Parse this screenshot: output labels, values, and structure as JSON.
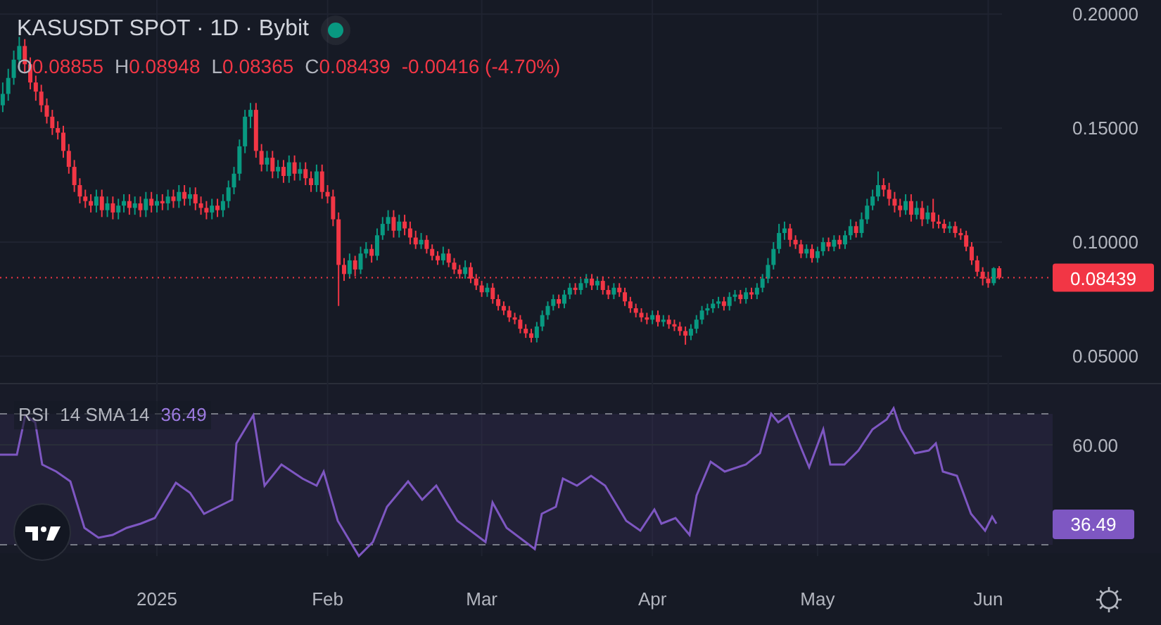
{
  "header": {
    "symbol_line": "KASUSDT SPOT · 1D · Bybit",
    "market_open": true,
    "ohlc": [
      {
        "label": "O",
        "value": "0.08855"
      },
      {
        "label": "H",
        "value": "0.08948"
      },
      {
        "label": "L",
        "value": "0.08365"
      },
      {
        "label": "C",
        "value": "0.08439"
      }
    ],
    "change": "-0.00416 (-4.70%)"
  },
  "price_chart": {
    "chart_data": {
      "type": "candlestick",
      "categories": [
        null,
        null,
        null,
        null,
        null,
        null,
        null,
        null,
        null,
        null,
        null,
        null,
        null,
        null,
        null,
        null,
        null,
        null,
        null,
        null,
        null,
        null,
        null,
        null,
        null,
        null,
        null,
        null,
        null,
        null,
        null,
        null,
        null,
        null,
        null,
        null,
        null,
        null,
        null,
        null,
        null,
        null,
        null,
        null,
        null,
        null,
        null,
        null,
        null,
        null,
        null,
        null,
        null,
        null,
        null,
        null,
        null,
        null,
        null,
        null,
        null,
        null,
        null,
        null,
        null,
        null,
        null,
        null,
        null,
        null,
        null,
        null,
        null,
        null,
        null,
        null,
        null,
        null,
        null,
        null,
        null,
        null,
        null,
        null,
        null,
        null,
        null,
        null,
        null,
        null,
        null,
        null,
        null,
        null,
        null,
        null,
        null,
        null,
        null,
        null,
        null,
        null,
        null,
        null,
        null,
        null,
        null,
        null,
        null,
        null,
        null,
        null,
        null,
        null,
        null,
        null,
        null,
        null,
        null,
        null,
        null,
        null,
        null,
        null,
        null,
        null,
        null,
        null,
        null,
        null,
        null,
        null,
        null,
        null,
        null,
        null,
        null,
        null,
        null,
        null,
        null,
        null,
        null,
        null,
        null,
        null,
        null,
        null,
        null,
        null,
        null,
        null,
        null,
        null,
        null,
        null,
        null,
        null,
        null,
        null,
        null,
        null,
        null,
        null,
        null,
        null,
        null,
        null,
        null,
        null,
        null,
        null,
        null,
        null,
        null,
        null,
        null,
        null,
        null,
        null,
        null,
        null
      ],
      "ohlc": [
        [
          0.16,
          0.17,
          0.157,
          0.165
        ],
        [
          0.165,
          0.176,
          0.162,
          0.172
        ],
        [
          0.172,
          0.184,
          0.169,
          0.18
        ],
        [
          0.18,
          0.19,
          0.176,
          0.186
        ],
        [
          0.186,
          0.189,
          0.174,
          0.178
        ],
        [
          0.178,
          0.181,
          0.167,
          0.17
        ],
        [
          0.17,
          0.173,
          0.162,
          0.166
        ],
        [
          0.166,
          0.169,
          0.157,
          0.16
        ],
        [
          0.16,
          0.163,
          0.152,
          0.155
        ],
        [
          0.155,
          0.158,
          0.147,
          0.15
        ],
        [
          0.15,
          0.153,
          0.145,
          0.148
        ],
        [
          0.148,
          0.151,
          0.137,
          0.14
        ],
        [
          0.14,
          0.143,
          0.13,
          0.133
        ],
        [
          0.133,
          0.136,
          0.122,
          0.125
        ],
        [
          0.125,
          0.128,
          0.117,
          0.12
        ],
        [
          0.12,
          0.123,
          0.115,
          0.118
        ],
        [
          0.118,
          0.121,
          0.113,
          0.116
        ],
        [
          0.116,
          0.123,
          0.113,
          0.12
        ],
        [
          0.12,
          0.123,
          0.111,
          0.114
        ],
        [
          0.114,
          0.12,
          0.111,
          0.117
        ],
        [
          0.117,
          0.12,
          0.11,
          0.113
        ],
        [
          0.113,
          0.119,
          0.11,
          0.116
        ],
        [
          0.116,
          0.121,
          0.113,
          0.118
        ],
        [
          0.118,
          0.121,
          0.112,
          0.115
        ],
        [
          0.115,
          0.12,
          0.112,
          0.117
        ],
        [
          0.117,
          0.12,
          0.111,
          0.114
        ],
        [
          0.114,
          0.122,
          0.111,
          0.119
        ],
        [
          0.119,
          0.122,
          0.113,
          0.116
        ],
        [
          0.116,
          0.121,
          0.113,
          0.118
        ],
        [
          0.118,
          0.121,
          0.114,
          0.117
        ],
        [
          0.117,
          0.123,
          0.114,
          0.12
        ],
        [
          0.12,
          0.123,
          0.115,
          0.118
        ],
        [
          0.118,
          0.125,
          0.115,
          0.122
        ],
        [
          0.122,
          0.125,
          0.116,
          0.119
        ],
        [
          0.119,
          0.124,
          0.116,
          0.121
        ],
        [
          0.121,
          0.124,
          0.114,
          0.117
        ],
        [
          0.117,
          0.12,
          0.112,
          0.115
        ],
        [
          0.115,
          0.118,
          0.11,
          0.113
        ],
        [
          0.113,
          0.119,
          0.11,
          0.116
        ],
        [
          0.116,
          0.119,
          0.111,
          0.114
        ],
        [
          0.114,
          0.121,
          0.111,
          0.118
        ],
        [
          0.118,
          0.127,
          0.115,
          0.124
        ],
        [
          0.124,
          0.133,
          0.121,
          0.13
        ],
        [
          0.13,
          0.145,
          0.127,
          0.142
        ],
        [
          0.142,
          0.158,
          0.139,
          0.155
        ],
        [
          0.155,
          0.161,
          0.15,
          0.158
        ],
        [
          0.158,
          0.161,
          0.137,
          0.14
        ],
        [
          0.14,
          0.143,
          0.131,
          0.134
        ],
        [
          0.134,
          0.14,
          0.131,
          0.137
        ],
        [
          0.137,
          0.14,
          0.128,
          0.131
        ],
        [
          0.131,
          0.136,
          0.128,
          0.133
        ],
        [
          0.133,
          0.136,
          0.126,
          0.129
        ],
        [
          0.129,
          0.138,
          0.126,
          0.135
        ],
        [
          0.135,
          0.138,
          0.127,
          0.13
        ],
        [
          0.13,
          0.135,
          0.127,
          0.132
        ],
        [
          0.132,
          0.135,
          0.125,
          0.128
        ],
        [
          0.128,
          0.131,
          0.122,
          0.125
        ],
        [
          0.125,
          0.134,
          0.122,
          0.131
        ],
        [
          0.131,
          0.134,
          0.119,
          0.122
        ],
        [
          0.122,
          0.125,
          0.117,
          0.12
        ],
        [
          0.12,
          0.123,
          0.107,
          0.11
        ],
        [
          0.11,
          0.113,
          0.072,
          0.09
        ],
        [
          0.09,
          0.093,
          0.083,
          0.086
        ],
        [
          0.086,
          0.095,
          0.084,
          0.092
        ],
        [
          0.092,
          0.094,
          0.085,
          0.088
        ],
        [
          0.088,
          0.098,
          0.086,
          0.095
        ],
        [
          0.095,
          0.1,
          0.093,
          0.097
        ],
        [
          0.097,
          0.099,
          0.091,
          0.094
        ],
        [
          0.094,
          0.106,
          0.092,
          0.103
        ],
        [
          0.103,
          0.111,
          0.101,
          0.108
        ],
        [
          0.108,
          0.114,
          0.105,
          0.111
        ],
        [
          0.111,
          0.114,
          0.102,
          0.105
        ],
        [
          0.105,
          0.112,
          0.102,
          0.109
        ],
        [
          0.109,
          0.112,
          0.103,
          0.106
        ],
        [
          0.106,
          0.109,
          0.099,
          0.102
        ],
        [
          0.102,
          0.105,
          0.097,
          0.099
        ],
        [
          0.099,
          0.104,
          0.097,
          0.101
        ],
        [
          0.101,
          0.103,
          0.095,
          0.097
        ],
        [
          0.097,
          0.099,
          0.092,
          0.094
        ],
        [
          0.094,
          0.096,
          0.09,
          0.092
        ],
        [
          0.092,
          0.098,
          0.09,
          0.095
        ],
        [
          0.095,
          0.097,
          0.089,
          0.091
        ],
        [
          0.091,
          0.093,
          0.086,
          0.088
        ],
        [
          0.088,
          0.09,
          0.084,
          0.086
        ],
        [
          0.086,
          0.092,
          0.084,
          0.089
        ],
        [
          0.089,
          0.091,
          0.082,
          0.084
        ],
        [
          0.084,
          0.086,
          0.079,
          0.081
        ],
        [
          0.081,
          0.083,
          0.076,
          0.078
        ],
        [
          0.078,
          0.082,
          0.076,
          0.08
        ],
        [
          0.08,
          0.082,
          0.073,
          0.075
        ],
        [
          0.075,
          0.077,
          0.07,
          0.072
        ],
        [
          0.072,
          0.074,
          0.068,
          0.07
        ],
        [
          0.07,
          0.072,
          0.065,
          0.067
        ],
        [
          0.067,
          0.069,
          0.064,
          0.066
        ],
        [
          0.066,
          0.068,
          0.06,
          0.062
        ],
        [
          0.062,
          0.064,
          0.058,
          0.06
        ],
        [
          0.06,
          0.062,
          0.056,
          0.058
        ],
        [
          0.058,
          0.065,
          0.056,
          0.063
        ],
        [
          0.063,
          0.07,
          0.061,
          0.068
        ],
        [
          0.068,
          0.074,
          0.066,
          0.072
        ],
        [
          0.072,
          0.077,
          0.07,
          0.075
        ],
        [
          0.075,
          0.077,
          0.071,
          0.073
        ],
        [
          0.073,
          0.079,
          0.071,
          0.077
        ],
        [
          0.077,
          0.082,
          0.075,
          0.08
        ],
        [
          0.08,
          0.082,
          0.077,
          0.079
        ],
        [
          0.079,
          0.084,
          0.077,
          0.082
        ],
        [
          0.082,
          0.086,
          0.08,
          0.084
        ],
        [
          0.084,
          0.086,
          0.079,
          0.081
        ],
        [
          0.081,
          0.085,
          0.079,
          0.083
        ],
        [
          0.083,
          0.085,
          0.077,
          0.079
        ],
        [
          0.079,
          0.081,
          0.075,
          0.077
        ],
        [
          0.077,
          0.082,
          0.075,
          0.08
        ],
        [
          0.08,
          0.082,
          0.076,
          0.078
        ],
        [
          0.078,
          0.08,
          0.072,
          0.074
        ],
        [
          0.074,
          0.076,
          0.069,
          0.071
        ],
        [
          0.071,
          0.073,
          0.067,
          0.069
        ],
        [
          0.069,
          0.071,
          0.065,
          0.067
        ],
        [
          0.067,
          0.069,
          0.064,
          0.066
        ],
        [
          0.066,
          0.07,
          0.064,
          0.068
        ],
        [
          0.068,
          0.07,
          0.063,
          0.065
        ],
        [
          0.065,
          0.068,
          0.063,
          0.066
        ],
        [
          0.066,
          0.068,
          0.062,
          0.064
        ],
        [
          0.064,
          0.066,
          0.061,
          0.063
        ],
        [
          0.063,
          0.065,
          0.059,
          0.061
        ],
        [
          0.061,
          0.063,
          0.055,
          0.059
        ],
        [
          0.059,
          0.064,
          0.057,
          0.062
        ],
        [
          0.062,
          0.068,
          0.06,
          0.066
        ],
        [
          0.066,
          0.072,
          0.064,
          0.07
        ],
        [
          0.07,
          0.073,
          0.068,
          0.071
        ],
        [
          0.071,
          0.075,
          0.069,
          0.073
        ],
        [
          0.073,
          0.076,
          0.071,
          0.074
        ],
        [
          0.074,
          0.076,
          0.07,
          0.072
        ],
        [
          0.072,
          0.078,
          0.07,
          0.076
        ],
        [
          0.076,
          0.079,
          0.074,
          0.077
        ],
        [
          0.077,
          0.079,
          0.073,
          0.075
        ],
        [
          0.075,
          0.08,
          0.073,
          0.078
        ],
        [
          0.078,
          0.08,
          0.075,
          0.077
        ],
        [
          0.077,
          0.082,
          0.075,
          0.08
        ],
        [
          0.08,
          0.086,
          0.078,
          0.084
        ],
        [
          0.084,
          0.093,
          0.082,
          0.09
        ],
        [
          0.09,
          0.1,
          0.088,
          0.097
        ],
        [
          0.097,
          0.108,
          0.095,
          0.104
        ],
        [
          0.104,
          0.109,
          0.101,
          0.106
        ],
        [
          0.106,
          0.108,
          0.098,
          0.101
        ],
        [
          0.101,
          0.103,
          0.097,
          0.099
        ],
        [
          0.099,
          0.101,
          0.093,
          0.095
        ],
        [
          0.095,
          0.099,
          0.093,
          0.097
        ],
        [
          0.097,
          0.099,
          0.091,
          0.093
        ],
        [
          0.093,
          0.098,
          0.091,
          0.096
        ],
        [
          0.096,
          0.102,
          0.094,
          0.1
        ],
        [
          0.1,
          0.102,
          0.096,
          0.098
        ],
        [
          0.098,
          0.103,
          0.096,
          0.101
        ],
        [
          0.101,
          0.103,
          0.097,
          0.099
        ],
        [
          0.099,
          0.105,
          0.097,
          0.103
        ],
        [
          0.103,
          0.11,
          0.101,
          0.107
        ],
        [
          0.107,
          0.109,
          0.102,
          0.104
        ],
        [
          0.104,
          0.113,
          0.102,
          0.11
        ],
        [
          0.11,
          0.119,
          0.108,
          0.116
        ],
        [
          0.116,
          0.123,
          0.114,
          0.12
        ],
        [
          0.12,
          0.131,
          0.118,
          0.125
        ],
        [
          0.125,
          0.128,
          0.12,
          0.123
        ],
        [
          0.123,
          0.126,
          0.116,
          0.119
        ],
        [
          0.119,
          0.122,
          0.113,
          0.116
        ],
        [
          0.116,
          0.119,
          0.111,
          0.114
        ],
        [
          0.114,
          0.121,
          0.112,
          0.118
        ],
        [
          0.118,
          0.121,
          0.109,
          0.112
        ],
        [
          0.112,
          0.118,
          0.11,
          0.115
        ],
        [
          0.115,
          0.118,
          0.107,
          0.11
        ],
        [
          0.11,
          0.116,
          0.108,
          0.113
        ],
        [
          0.113,
          0.119,
          0.106,
          0.109
        ],
        [
          0.109,
          0.112,
          0.106,
          0.108
        ],
        [
          0.108,
          0.11,
          0.104,
          0.106
        ],
        [
          0.106,
          0.109,
          0.104,
          0.107
        ],
        [
          0.107,
          0.109,
          0.102,
          0.104
        ],
        [
          0.104,
          0.106,
          0.101,
          0.103
        ],
        [
          0.103,
          0.105,
          0.096,
          0.098
        ],
        [
          0.098,
          0.1,
          0.09,
          0.092
        ],
        [
          0.092,
          0.094,
          0.085,
          0.087
        ],
        [
          0.087,
          0.089,
          0.081,
          0.084
        ],
        [
          0.084,
          0.087,
          0.08,
          0.082
        ],
        [
          0.082,
          0.089,
          0.081,
          0.08855
        ],
        [
          0.08855,
          0.08948,
          0.08365,
          0.08439
        ]
      ],
      "ylim": [
        0.03827,
        0.20617
      ],
      "grid": true,
      "ref_lines": [
        {
          "axis": "y",
          "value": 0.08439
        }
      ],
      "yticks": [
        {
          "value": 0.2,
          "label": "0.20000"
        },
        {
          "value": 0.15,
          "label": "0.15000"
        },
        {
          "value": 0.1,
          "label": "0.10000"
        },
        {
          "value": 0.05,
          "label": "0.05000"
        }
      ]
    },
    "last_price": "0.08439"
  },
  "rsi": {
    "name": "RSI",
    "params": "14 SMA 14",
    "value": "36.49",
    "axis_ticks": [
      "60.00"
    ],
    "axis_value": "36.49"
  },
  "time_axis": [
    "2025",
    "Feb",
    "Mar",
    "Apr",
    "May",
    "Jun"
  ]
}
